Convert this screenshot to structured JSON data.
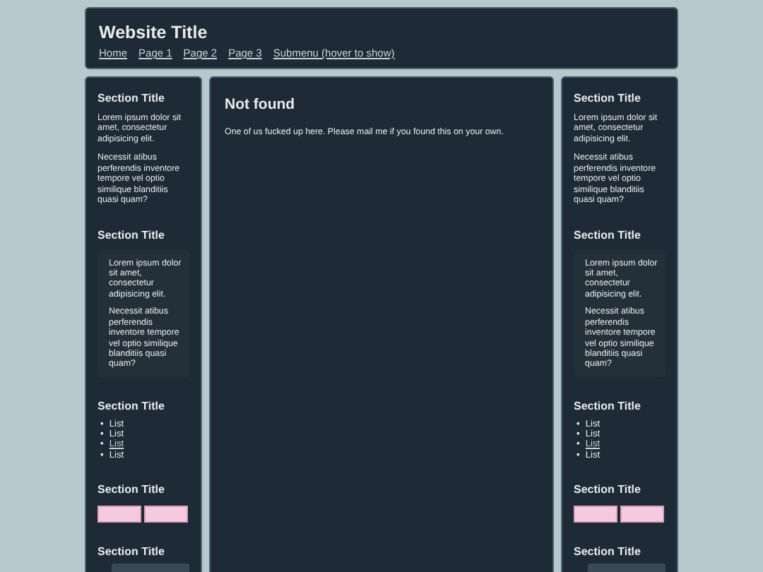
{
  "header": {
    "title": "Website Title",
    "nav": [
      {
        "label": "Home"
      },
      {
        "label": "Page 1"
      },
      {
        "label": "Page 2"
      },
      {
        "label": "Page 3"
      },
      {
        "label": "Submenu (hover to show)"
      }
    ]
  },
  "left_sidebar": {
    "sections": [
      {
        "kind": "text",
        "title": "Section Title",
        "paragraphs": [
          "Lorem ipsum dolor sit amet, consectetur adipisicing elit.",
          "Necessit atibus perferendis inventore tempore vel optio similique blanditiis quasi quam?"
        ]
      },
      {
        "kind": "boxed",
        "title": "Section Title",
        "paragraphs": [
          "Lorem ipsum dolor sit amet, consectetur adipisicing elit.",
          "Necessit atibus perferendis inventore tempore vel optio similique blanditiis quasi quam?"
        ]
      },
      {
        "kind": "list",
        "title": "Section Title",
        "items": [
          {
            "marker": "•",
            "label": "List",
            "link": false
          },
          {
            "marker": "•",
            "label": "List",
            "link": false
          },
          {
            "marker": "•",
            "label": "List",
            "link": true
          },
          {
            "marker": "•",
            "label": "List",
            "link": false
          }
        ]
      },
      {
        "kind": "badges",
        "title": "Section Title"
      },
      {
        "kind": "field",
        "title": "Section Title"
      }
    ]
  },
  "main": {
    "title": "Not found",
    "text": "One of us fucked up here. Please mail me if you found this on your own."
  },
  "right_sidebar": {
    "sections": [
      {
        "kind": "text",
        "title": "Section Title",
        "paragraphs": [
          "Lorem ipsum dolor sit amet, consectetur adipisicing elit.",
          "Necessit atibus perferendis inventore tempore vel optio similique blanditiis quasi quam?"
        ]
      },
      {
        "kind": "boxed",
        "title": "Section Title",
        "paragraphs": [
          "Lorem ipsum dolor sit amet, consectetur adipisicing elit.",
          "Necessit atibus perferendis inventore tempore vel optio similique blanditiis quasi quam?"
        ]
      },
      {
        "kind": "list",
        "title": "Section Title",
        "items": [
          {
            "marker": "•",
            "label": "List",
            "link": false
          },
          {
            "marker": "•",
            "label": "List",
            "link": false
          },
          {
            "marker": "•",
            "label": "List",
            "link": true
          },
          {
            "marker": "•",
            "label": "List",
            "link": false
          }
        ]
      },
      {
        "kind": "badges",
        "title": "Section Title"
      },
      {
        "kind": "field",
        "title": "Section Title"
      }
    ]
  }
}
